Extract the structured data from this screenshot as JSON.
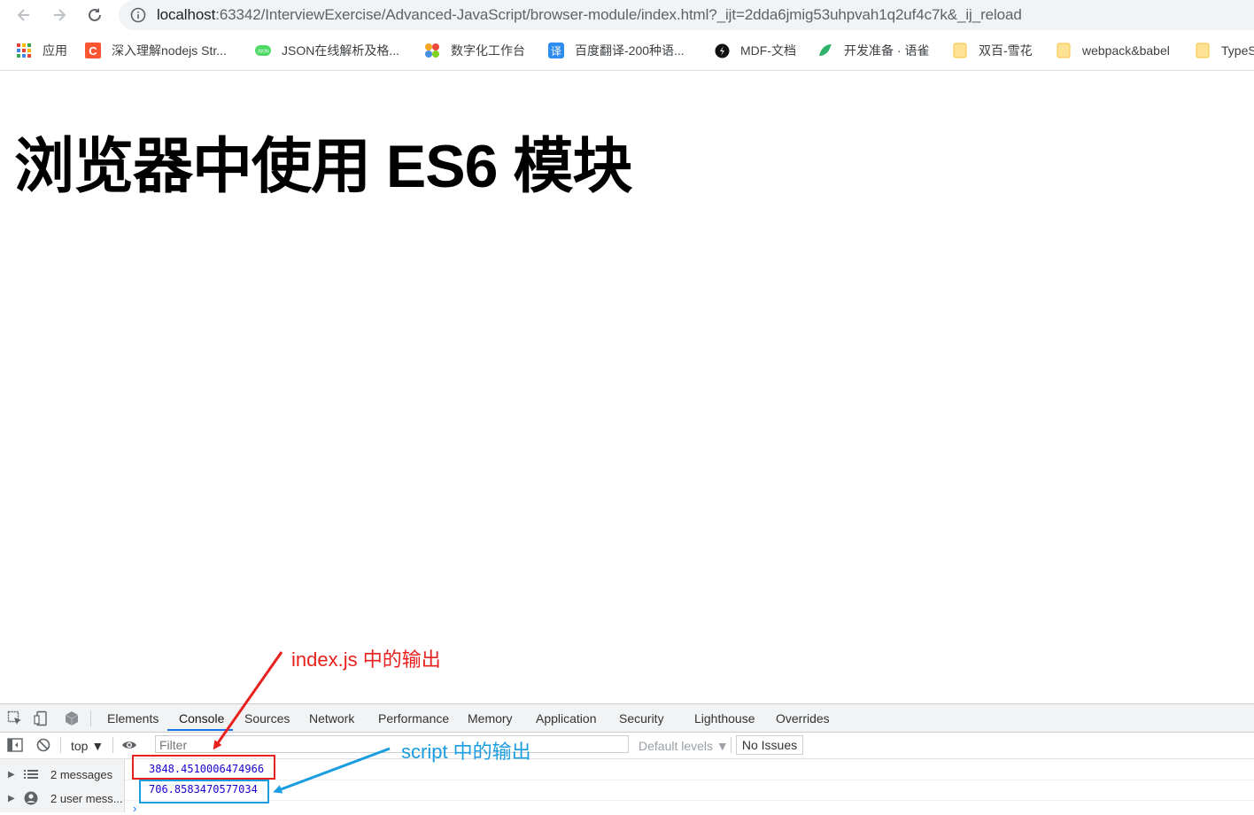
{
  "toolbar": {
    "url_host": "localhost",
    "url_rest": ":63342/InterviewExercise/Advanced-JavaScript/browser-module/index.html?_ijt=2dda6jmig53uhpvah1q2uf4c7k&_ij_reload"
  },
  "bookmarks": [
    {
      "label": "应用",
      "icon": "apps-grid-icon"
    },
    {
      "label": "深入理解nodejs Str...",
      "icon": "csdn-icon",
      "color": "#fc5531"
    },
    {
      "label": "JSON在线解析及格...",
      "icon": "json-icon",
      "color": "#4cd964"
    },
    {
      "label": "数字化工作台",
      "icon": "colorful-dots-icon"
    },
    {
      "label": "百度翻译-200种语...",
      "icon": "translate-icon",
      "color": "#2d8cf0"
    },
    {
      "label": "MDF-文档",
      "icon": "mdf-icon"
    },
    {
      "label": "开发准备 · 语雀",
      "icon": "yuque-icon",
      "color": "#2fb36a"
    },
    {
      "label": "双百-雪花",
      "icon": "folder-icon"
    },
    {
      "label": "webpack&babel",
      "icon": "folder-icon"
    },
    {
      "label": "TypeS",
      "icon": "folder-icon"
    }
  ],
  "page": {
    "heading": "浏览器中使用 ES6 模块"
  },
  "annotations": {
    "red_label": "index.js 中的输出",
    "blue_label": "script 中的输出",
    "red_color": "#e8201e",
    "blue_color": "#1a9de0"
  },
  "devtools": {
    "tabs": [
      "Elements",
      "Console",
      "Sources",
      "Network",
      "Performance",
      "Memory",
      "Application",
      "Security",
      "Lighthouse",
      "Overrides"
    ],
    "active_tab": "Console",
    "context": "top ▼",
    "filter_placeholder": "Filter",
    "levels": "Default levels ▼",
    "issues": "No Issues",
    "sidebar": [
      {
        "label": "2 messages",
        "icon": "list-icon"
      },
      {
        "label": "2 user mess...",
        "icon": "user-icon"
      }
    ],
    "logs": [
      "3848.4510006474966",
      "706.8583470577034"
    ],
    "prompt": "›"
  }
}
